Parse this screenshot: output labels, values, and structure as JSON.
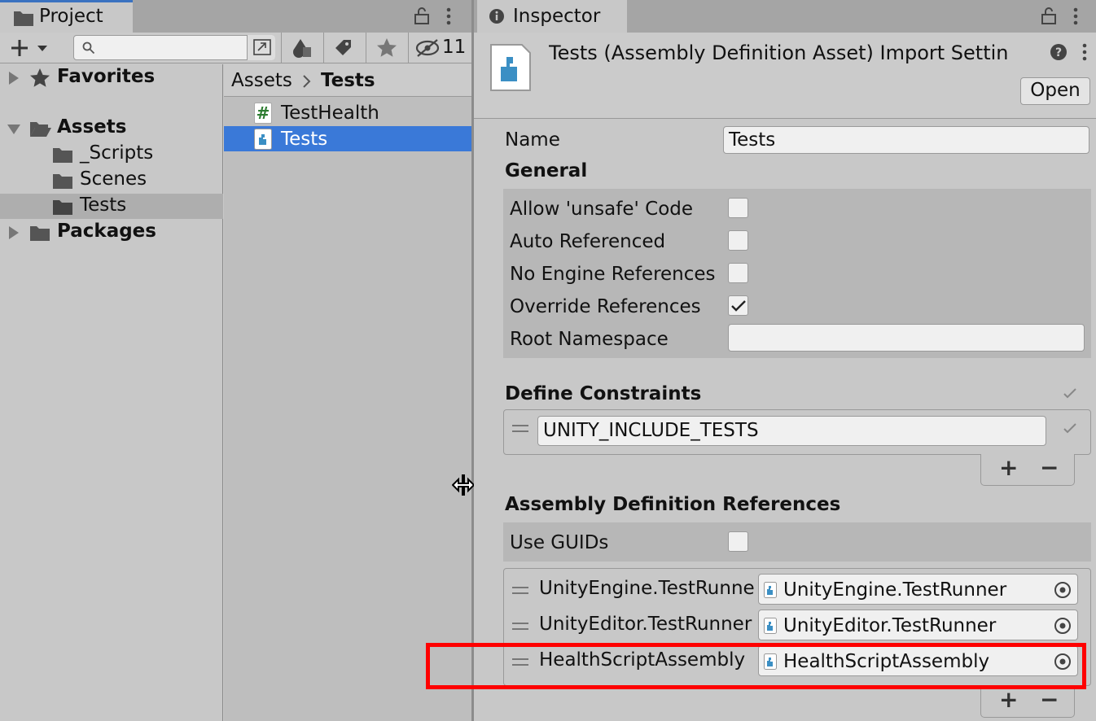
{
  "project": {
    "tab_label": "Project",
    "hidden_count": "11",
    "search": {
      "value": "",
      "placeholder": ""
    },
    "tree": {
      "favorites": "Favorites",
      "assets": "Assets",
      "scripts": "_Scripts",
      "scenes": "Scenes",
      "tests": "Tests",
      "packages": "Packages"
    },
    "breadcrumb": {
      "root": "Assets",
      "current": "Tests"
    },
    "files": [
      {
        "name": "TestHealth"
      },
      {
        "name": "Tests"
      }
    ]
  },
  "inspector": {
    "tab_label": "Inspector",
    "header_title": "Tests (Assembly Definition Asset) Import Settin",
    "open_button": "Open",
    "name_label": "Name",
    "name_value": "Tests",
    "general_heading": "General",
    "general_fields": [
      {
        "label": "Allow 'unsafe' Code",
        "checked": false
      },
      {
        "label": "Auto Referenced",
        "checked": false
      },
      {
        "label": "No Engine References",
        "checked": false
      },
      {
        "label": "Override References",
        "checked": true
      }
    ],
    "root_namespace_label": "Root Namespace",
    "root_namespace_value": "",
    "define_constraints_heading": "Define Constraints",
    "define_constraints": [
      "UNITY_INCLUDE_TESTS"
    ],
    "asm_refs_heading": "Assembly Definition References",
    "use_guids_label": "Use GUIDs",
    "use_guids_checked": false,
    "asm_refs": [
      {
        "label": "UnityEngine.TestRunne",
        "value": "UnityEngine.TestRunner"
      },
      {
        "label": "UnityEditor.TestRunner",
        "value": "UnityEditor.TestRunner"
      },
      {
        "label": "HealthScriptAssembly",
        "value": "HealthScriptAssembly"
      }
    ],
    "add_symbol": "+",
    "remove_symbol": "−"
  },
  "icons": {
    "folder": "folder-icon",
    "search": "search-icon",
    "lock": "lock-icon",
    "more": "kebab-menu-icon",
    "info": "info-icon",
    "help": "help-icon",
    "script": "cs-script-icon",
    "asmdef": "assembly-definition-icon",
    "object_picker": "object-picker-icon",
    "drag_handle": "drag-handle-icon",
    "resize_cursor": "resize-cursor-icon"
  },
  "colors": {
    "selection": "#3a79d8",
    "highlight_box": "#ff0000",
    "tab_accent": "#3a72c0"
  }
}
